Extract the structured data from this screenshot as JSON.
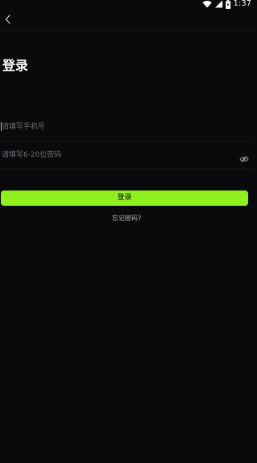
{
  "status_bar": {
    "time": "1:37"
  },
  "nav": {
    "back_icon": "chevron-left-icon"
  },
  "page": {
    "title": "登录"
  },
  "form": {
    "phone": {
      "placeholder": "请填写手机号",
      "value": ""
    },
    "password": {
      "placeholder": "请填写6-20位密码",
      "value": "",
      "toggle_icon": "eye-icon"
    },
    "login_label": "登录",
    "forgot_label": "忘记密码?"
  },
  "colors": {
    "background": "#0a0a0c",
    "accent": "#8ef01c",
    "placeholder": "#6e6e73"
  }
}
